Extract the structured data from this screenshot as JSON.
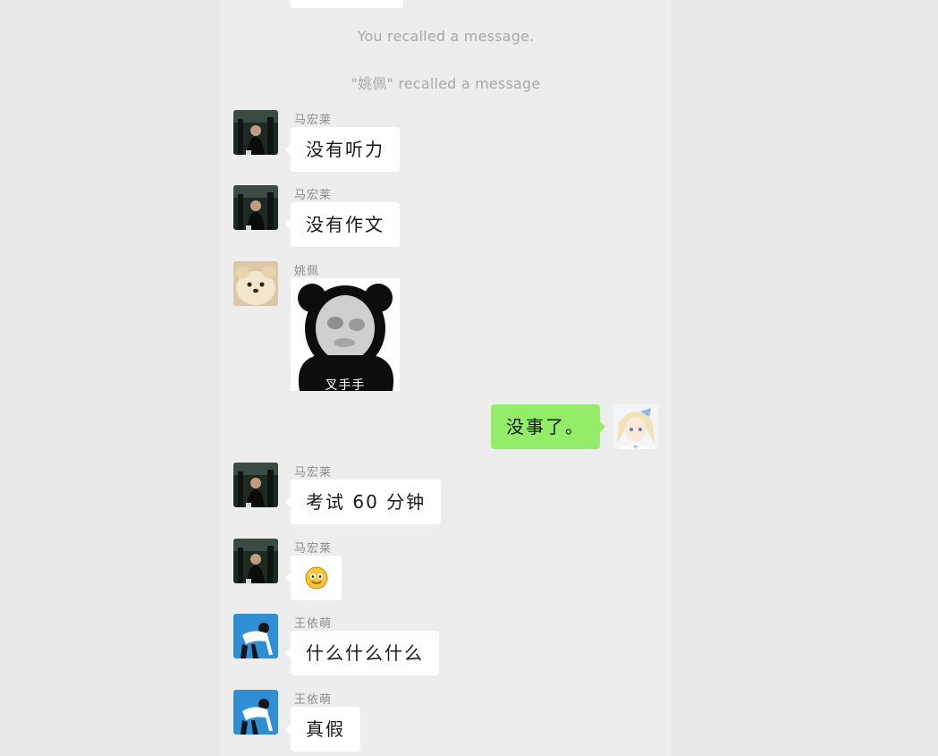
{
  "system_messages": {
    "self_recall": "You recalled a message.",
    "other_recall": "\"姚佩\" recalled a message"
  },
  "messages": [
    {
      "sender": "马宏莱",
      "text": "没有听力"
    },
    {
      "sender": "马宏莱",
      "text": "没有作文"
    },
    {
      "sender": "姚佩",
      "sticker_caption": "叉手手"
    },
    {
      "text": "没事了。"
    },
    {
      "sender": "马宏莱",
      "text": "考试 60 分钟"
    },
    {
      "sender": "马宏莱",
      "emoji": "smile-emoji"
    },
    {
      "sender": "王依萌",
      "text": "什么什么什么"
    },
    {
      "sender": "王依萌",
      "text": "真假"
    }
  ],
  "colors": {
    "chat_background": "#ededed",
    "outside_background": "#e7e7e7",
    "incoming_bubble": "#ffffff",
    "outgoing_bubble": "#95ec69",
    "system_text": "#a8a8a8",
    "sender_name": "#8c8c8c"
  }
}
